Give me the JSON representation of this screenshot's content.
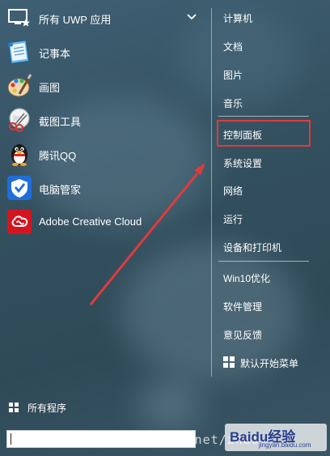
{
  "header": {
    "title": "所有 UWP 应用"
  },
  "apps": [
    {
      "label": "记事本",
      "icon": "notepad-icon"
    },
    {
      "label": "画图",
      "icon": "paint-icon"
    },
    {
      "label": "截图工具",
      "icon": "snipping-tool-icon"
    },
    {
      "label": "腾讯QQ",
      "icon": "qq-penguin-icon"
    },
    {
      "label": "电脑管家",
      "icon": "pc-manager-shield-icon"
    },
    {
      "label": "Adobe Creative Cloud",
      "icon": "adobe-cc-icon"
    }
  ],
  "all_programs": {
    "label": "所有程序"
  },
  "search": {
    "value": ""
  },
  "right_menu": {
    "group1": [
      "计算机",
      "文档",
      "图片",
      "音乐"
    ],
    "group2": [
      "控制面板",
      "系统设置",
      "网络",
      "运行",
      "设备和打印机"
    ],
    "group3": [
      "Win10优化",
      "软件管理",
      "意见反馈",
      "默认开始菜单"
    ]
  },
  "highlighted_item": "控制面板",
  "watermark": {
    "url": "https://blog.csdn.net/zhao",
    "baidu_logo": "Baidu经验",
    "baidu_sub": "jingyan.baidu.com"
  },
  "colors": {
    "highlight_border": "#e03b3b",
    "arrow": "#e03b3b",
    "text": "#ffffff"
  }
}
